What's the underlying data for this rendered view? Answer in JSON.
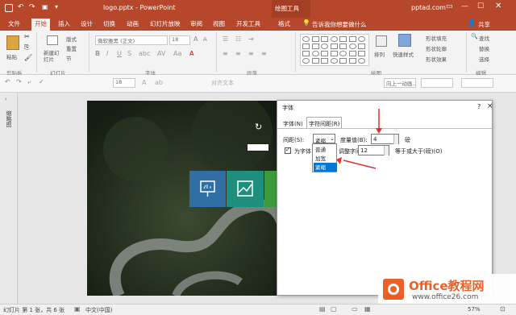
{
  "title_bar": {
    "filename": "logo.pptx - PowerPoint",
    "context_tab": "绘图工具",
    "account": "pptad.com",
    "share": "共享"
  },
  "tabs": [
    {
      "label": "文件"
    },
    {
      "label": "开始",
      "active": true
    },
    {
      "label": "插入"
    },
    {
      "label": "设计"
    },
    {
      "label": "切换"
    },
    {
      "label": "动画"
    },
    {
      "label": "幻灯片放映"
    },
    {
      "label": "审阅"
    },
    {
      "label": "视图"
    },
    {
      "label": "开发工具"
    },
    {
      "label": "格式"
    }
  ],
  "tell_me": "告诉我你想要做什么",
  "ribbon": {
    "paste": "粘贴",
    "new_slide": "新建幻灯片",
    "layout": "版式",
    "reset": "重置",
    "section": "节",
    "font_name": "微软雅黑 (正文)",
    "font_size": "18",
    "arrange": "排列",
    "quick_styles": "快速样式",
    "shape_fill": "形状填充",
    "shape_outline": "形状轮廓",
    "shape_effects": "形状效果",
    "find": "查找",
    "replace": "替换",
    "select": "选择",
    "groups": [
      "剪贴板",
      "幻灯片",
      "字体",
      "段落",
      "绘图",
      "编辑"
    ]
  },
  "format_bar": {
    "font_size": "18",
    "align_text": "对齐文本",
    "line_with_direction": "向上一动画..."
  },
  "left_pane": {
    "label": "缩略图"
  },
  "dialog": {
    "title": "字体",
    "help": "?",
    "close": "×",
    "tab_font": "字体(N)",
    "tab_spacing": "字符间距(R)",
    "spacing_label": "间距(S):",
    "spacing_value": "紧缩",
    "measure_label": "度量值(B):",
    "measure_value": "4",
    "measure_unit": "磅",
    "kerning_label": "为字体",
    "kerning_label2": "调整字间距(K):",
    "kerning_value": "12",
    "kerning_suffix": "等于或大于(磅)(O)",
    "dropdown_options": [
      "普通",
      "加宽",
      "紧缩"
    ],
    "selected_option": "紧缩"
  },
  "status": {
    "slide_info": "幻灯片 第 1 张，共 6 张",
    "language": "中文(中国)",
    "zoom": "57%"
  },
  "watermark": {
    "brand": "Office教程网",
    "url": "www.office26.com"
  },
  "colors": {
    "accent": "#b7472a",
    "arrow": "#e03030",
    "tile_blue": "#2f6fa5",
    "tile_teal": "#1e8e7e",
    "tile_green": "#3b9b3b",
    "office_orange": "#ea5a1e"
  }
}
